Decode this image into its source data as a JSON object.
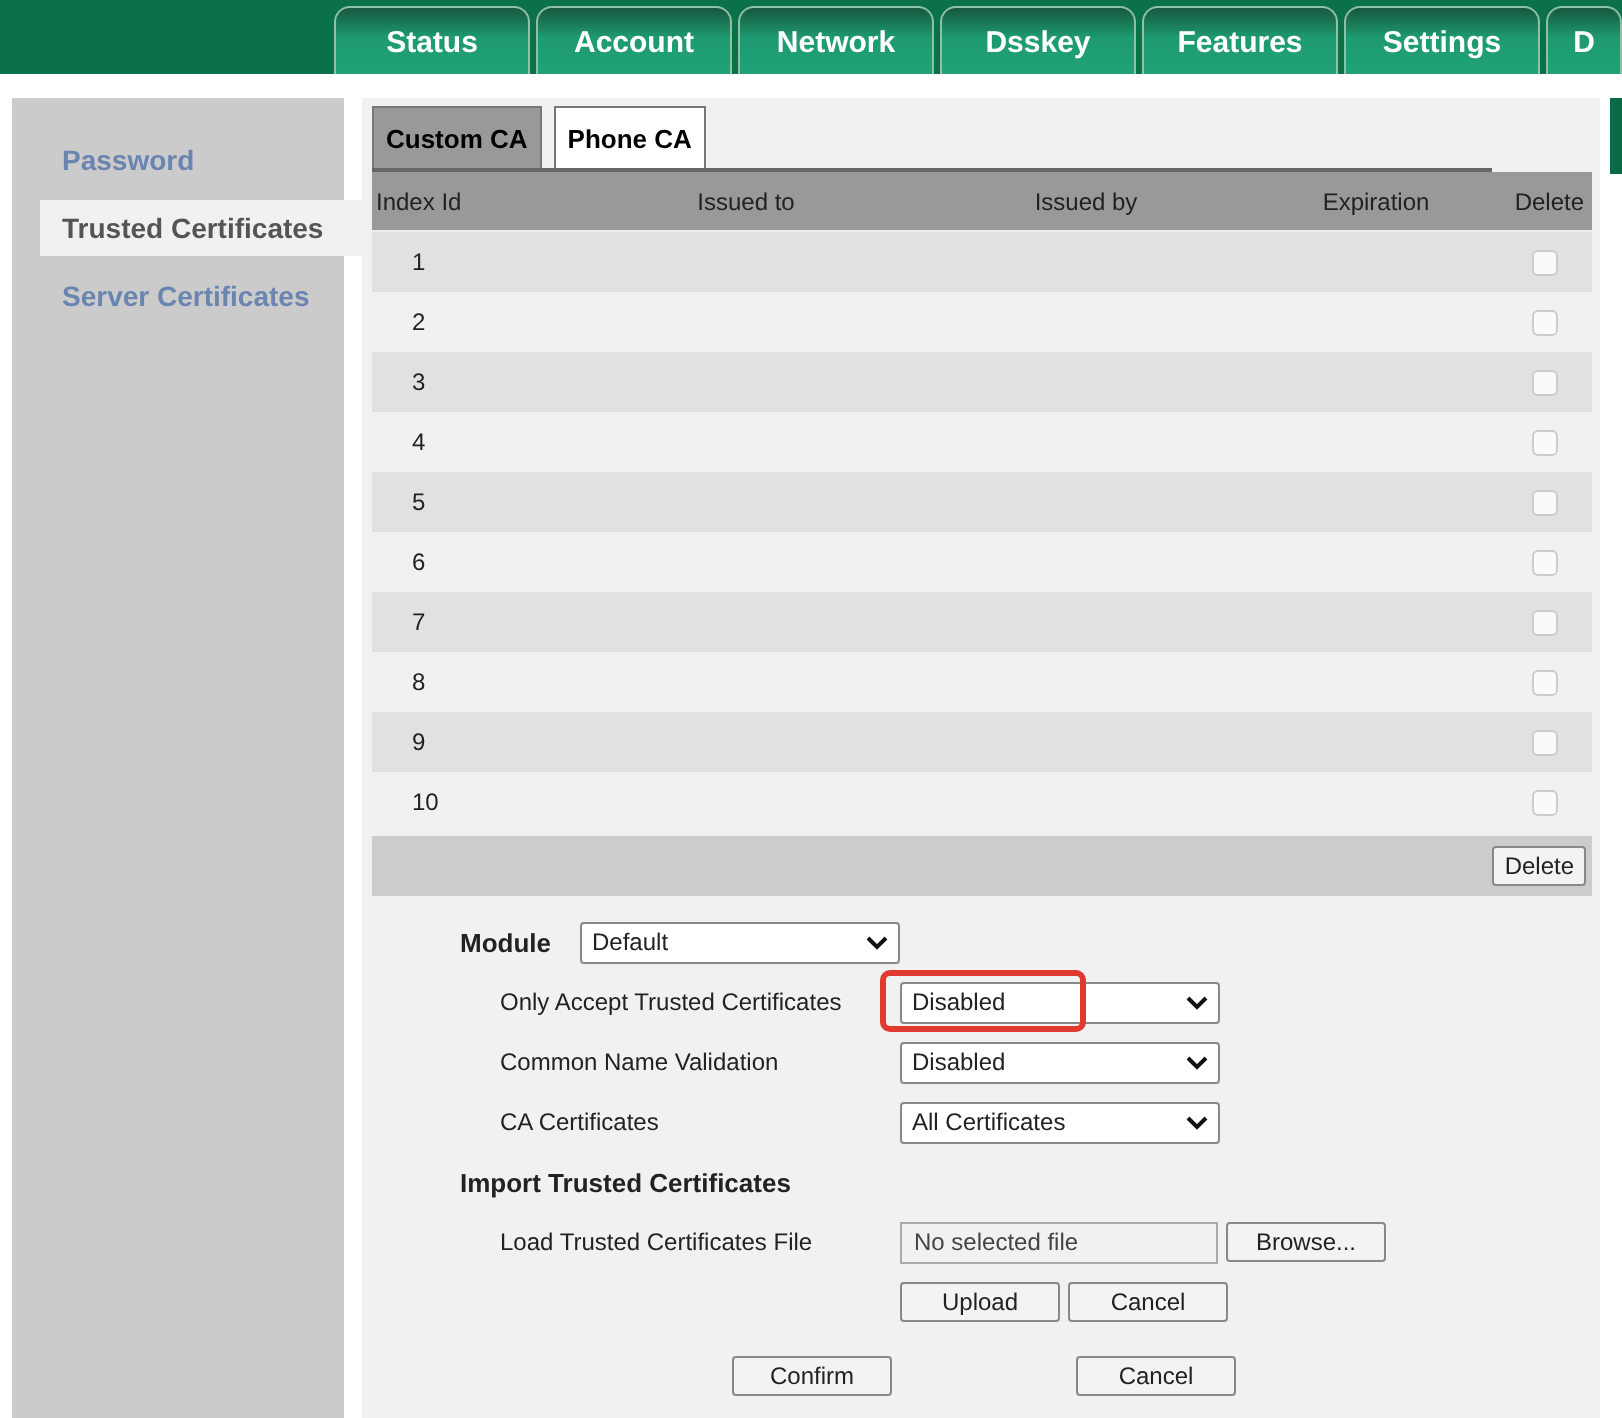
{
  "nav_tabs": [
    {
      "label": "Status",
      "selected": false
    },
    {
      "label": "Account",
      "selected": false
    },
    {
      "label": "Network",
      "selected": false
    },
    {
      "label": "Dsskey",
      "selected": false
    },
    {
      "label": "Features",
      "selected": false
    },
    {
      "label": "Settings",
      "selected": false
    },
    {
      "label": "D",
      "selected": false
    }
  ],
  "sidebar": {
    "items": [
      {
        "label": "Password",
        "selected": false
      },
      {
        "label": "Trusted Certificates",
        "selected": true
      },
      {
        "label": "Server Certificates",
        "selected": false
      }
    ]
  },
  "sub_tabs": [
    {
      "label": "Custom CA",
      "selected": true
    },
    {
      "label": "Phone CA",
      "selected": false
    }
  ],
  "table": {
    "columns": [
      "Index Id",
      "Issued to",
      "Issued by",
      "Expiration",
      "Delete"
    ],
    "rows": [
      {
        "index": "1",
        "checked": false
      },
      {
        "index": "2",
        "checked": false
      },
      {
        "index": "3",
        "checked": false
      },
      {
        "index": "4",
        "checked": false
      },
      {
        "index": "5",
        "checked": false
      },
      {
        "index": "6",
        "checked": false
      },
      {
        "index": "7",
        "checked": false
      },
      {
        "index": "8",
        "checked": false
      },
      {
        "index": "9",
        "checked": false
      },
      {
        "index": "10",
        "checked": false
      }
    ],
    "delete_button": "Delete"
  },
  "module": {
    "label": "Module",
    "value": "Default"
  },
  "settings": [
    {
      "label": "Only Accept Trusted Certificates",
      "value": "Disabled",
      "highlighted": true
    },
    {
      "label": "Common Name Validation",
      "value": "Disabled",
      "highlighted": false
    },
    {
      "label": "CA Certificates",
      "value": "All Certificates",
      "highlighted": false
    }
  ],
  "import": {
    "heading": "Import Trusted Certificates",
    "label": "Load Trusted Certificates File",
    "file_value": "No selected file",
    "browse": "Browse...",
    "upload": "Upload",
    "cancel": "Cancel"
  },
  "footer_buttons": [
    "Confirm",
    "Cancel"
  ]
}
